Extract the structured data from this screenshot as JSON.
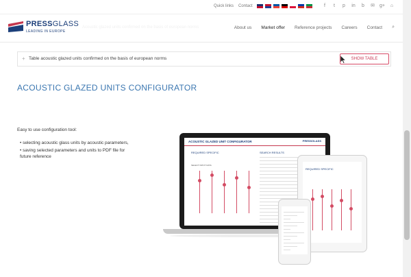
{
  "topbar": {
    "quick_links": "Quick links",
    "contact": "Contact",
    "flags": [
      {
        "code": "gb",
        "colors": [
          "#1d2e6e",
          "#c8102e"
        ]
      },
      {
        "code": "hr",
        "colors": [
          "#c8102e",
          "#1d3f94"
        ]
      },
      {
        "code": "fr",
        "colors": [
          "#0055a4",
          "#ef4135"
        ]
      },
      {
        "code": "de",
        "colors": [
          "#000000",
          "#dd0000"
        ]
      },
      {
        "code": "pl",
        "colors": [
          "#ffffff",
          "#dc143c"
        ]
      },
      {
        "code": "ru",
        "colors": [
          "#0039a6",
          "#d52b1e"
        ]
      },
      {
        "code": "it",
        "colors": [
          "#009246",
          "#ce2b37"
        ]
      }
    ],
    "socials": [
      "f",
      "t",
      "p",
      "in",
      "b",
      "✉",
      "g+",
      "⌂"
    ]
  },
  "header": {
    "logo_press": "PRESS",
    "logo_glass": "GLASS",
    "logo_tagline": "LEADING IN EUROPE",
    "ghost_text": "Acoustic glazed units confirmed on the basis of european norms",
    "nav": [
      "About us",
      "Market offer",
      "Reference projects",
      "Careers",
      "Contact"
    ],
    "active_nav": "Market offer"
  },
  "notice": {
    "text": "Table acoustic glazed units confirmed on the basis of european norms",
    "button": "SHOW TABLE"
  },
  "main": {
    "title": "ACOUSTIC GLAZED UNITS CONFIGURATOR",
    "intro": "Easy to use configuration tool:",
    "bullets": [
      "• selecting acoustic glass units by acoustic parameters,",
      "• saving selected parameters and units to PDF file for future reference"
    ]
  },
  "screen": {
    "title": "ACOUSTIC GLAZED UNIT CONFIGURATOR",
    "logo": "PRESSGLASS",
    "left_heading": "REQUIRED SPECIFIC",
    "right_heading": "SEARCH RESULTS",
    "select": "SELECT INPUT DATA"
  },
  "tablet": {
    "title": "REQUIRED SPECIFIC"
  },
  "colors": {
    "brand": "#1c3f7a",
    "accent": "#d34b63",
    "title": "#3a76b0"
  }
}
